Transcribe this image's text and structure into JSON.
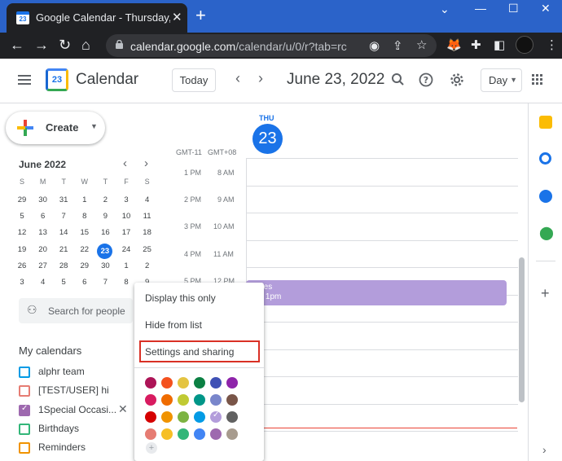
{
  "browser": {
    "tab_title": "Google Calendar - Thursday, June",
    "tab_favicon": "23",
    "new_tab": "+",
    "url_host": "calendar.google.com",
    "url_path": "/calendar/u/0/r?tab=rc"
  },
  "header": {
    "app_title": "Calendar",
    "logo_day": "23",
    "today_label": "Today",
    "date_title": "June 23, 2022",
    "view_label": "Day"
  },
  "sidebar": {
    "create_label": "Create",
    "mini_month": "June 2022",
    "weekday_headers": [
      "S",
      "M",
      "T",
      "W",
      "T",
      "F",
      "S"
    ],
    "weeks": [
      [
        "29",
        "30",
        "31",
        "1",
        "2",
        "3",
        "4"
      ],
      [
        "5",
        "6",
        "7",
        "8",
        "9",
        "10",
        "11"
      ],
      [
        "12",
        "13",
        "14",
        "15",
        "16",
        "17",
        "18"
      ],
      [
        "19",
        "20",
        "21",
        "22",
        "23",
        "24",
        "25"
      ],
      [
        "26",
        "27",
        "28",
        "29",
        "30",
        "1",
        "2"
      ],
      [
        "3",
        "4",
        "5",
        "6",
        "7",
        "8",
        "9"
      ]
    ],
    "today": "23",
    "search_placeholder": "Search for people",
    "my_calendars_label": "My calendars",
    "calendars": [
      {
        "name": "alphr team",
        "color": "#039be5",
        "checked": false
      },
      {
        "name": "[TEST/USER] hi",
        "color": "#e67c73",
        "checked": false
      },
      {
        "name": "1Special Occasi...",
        "color": "#9e69af",
        "checked": true
      },
      {
        "name": "Birthdays",
        "color": "#33b679",
        "checked": false
      },
      {
        "name": "Reminders",
        "color": "#f09300",
        "checked": false
      }
    ],
    "close_symbol": "✕"
  },
  "day_view": {
    "day_name": "THU",
    "day_number": "23",
    "tz_left": "GMT-11",
    "tz_right": "GMT+08",
    "time_rows": [
      {
        "left": "1 PM",
        "right": "8 AM"
      },
      {
        "left": "2 PM",
        "right": "9 AM"
      },
      {
        "left": "3 PM",
        "right": "10 AM"
      },
      {
        "left": "4 PM",
        "right": "11 AM"
      },
      {
        "left": "5 PM",
        "right": "12 PM"
      }
    ],
    "event_title": "...res",
    "event_time": "..., 1pm",
    "event_color": "#b39ddb"
  },
  "context_menu": {
    "display_only": "Display this only",
    "hide": "Hide from list",
    "settings": "Settings and sharing",
    "highlight_color": "#d93025",
    "swatches": [
      [
        "#ad1457",
        "#f4511e",
        "#e4c441",
        "#0b8043",
        "#3f51b5",
        "#8e24aa"
      ],
      [
        "#d81b60",
        "#ef6c00",
        "#c0ca33",
        "#009688",
        "#7986cb",
        "#795548"
      ],
      [
        "#d50000",
        "#f09300",
        "#7cb342",
        "#039be5",
        "#b39ddb",
        "#616161"
      ],
      [
        "#e67c73",
        "#f6bf26",
        "#33b679",
        "#4285f4",
        "#9e69af",
        "#a79b8e"
      ]
    ],
    "add_symbol": "+"
  },
  "icons": {
    "menu": "hamburger-icon",
    "search": "search-icon",
    "help": "help-icon",
    "settings": "gear-icon",
    "apps": "apps-grid-icon"
  }
}
